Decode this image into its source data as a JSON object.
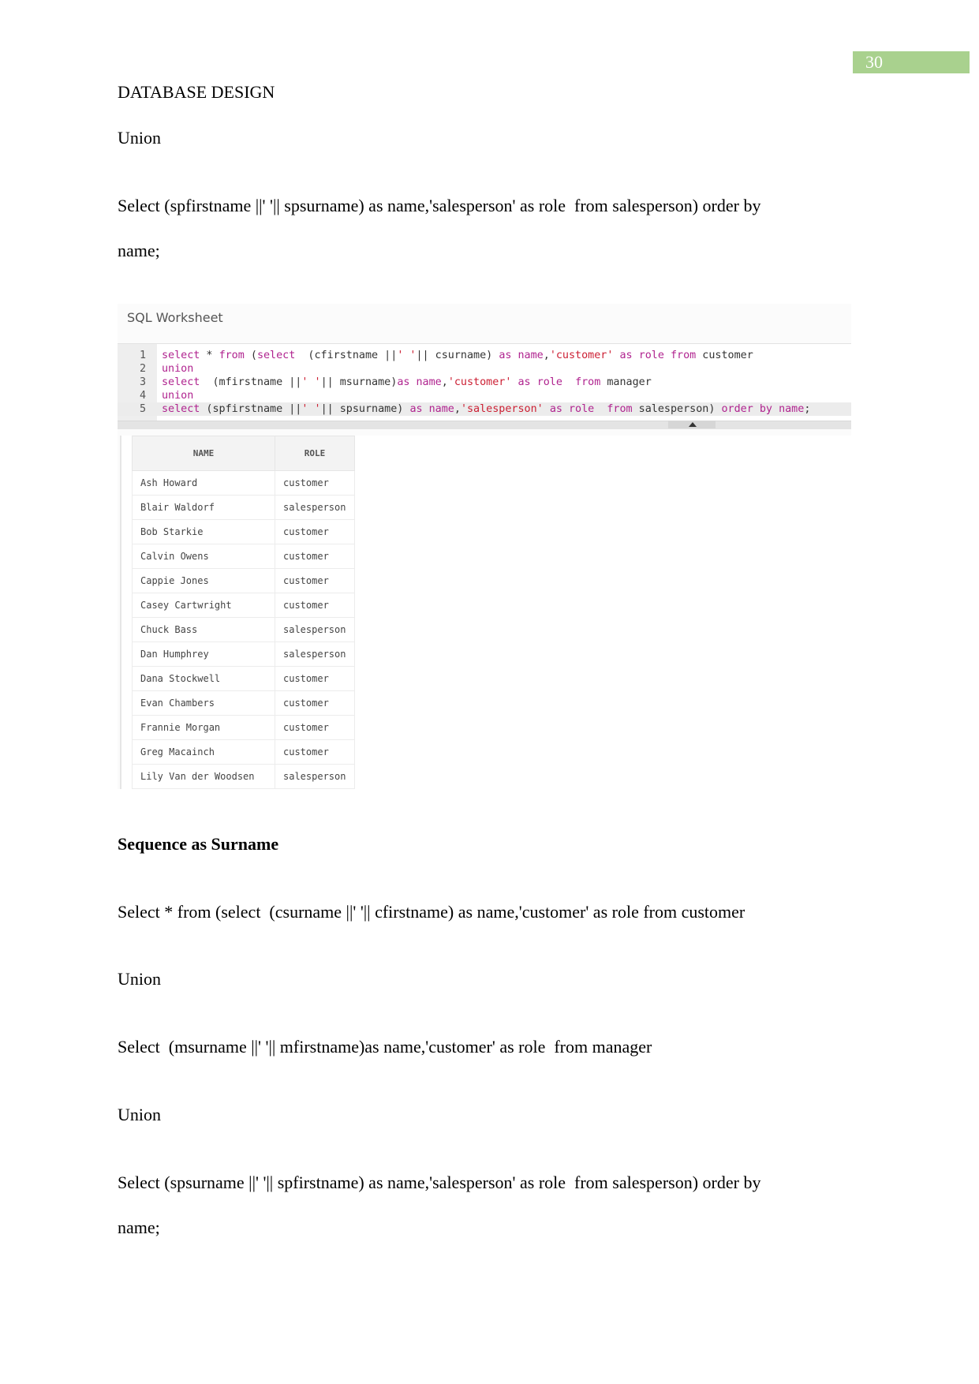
{
  "page": {
    "number": "30",
    "header": "DATABASE DESIGN",
    "accent_color": "#a9d18e"
  },
  "section1": {
    "line_union": "Union",
    "query_line1": "Select (spfirstname ||' '|| spsurname) as name,'salesperson' as role  from salesperson) order by",
    "query_line2": "name;"
  },
  "worksheet": {
    "title": "SQL Worksheet",
    "code_lines": [
      {
        "n": "1",
        "segments": [
          [
            "kw",
            "select"
          ],
          [
            "p",
            " * "
          ],
          [
            "kw",
            "from"
          ],
          [
            "p",
            " ("
          ],
          [
            "kw",
            "select"
          ],
          [
            "p",
            "  (cfirstname ||"
          ],
          [
            "str",
            "' '"
          ],
          [
            "p",
            "|| csurname) "
          ],
          [
            "kw",
            "as"
          ],
          [
            "p",
            " "
          ],
          [
            "kw",
            "name"
          ],
          [
            "p",
            ","
          ],
          [
            "str",
            "'customer'"
          ],
          [
            "p",
            " "
          ],
          [
            "kw",
            "as"
          ],
          [
            "p",
            " "
          ],
          [
            "kw",
            "role"
          ],
          [
            "p",
            " "
          ],
          [
            "kw",
            "from"
          ],
          [
            "p",
            " customer"
          ]
        ]
      },
      {
        "n": "2",
        "segments": [
          [
            "kw",
            "union"
          ]
        ]
      },
      {
        "n": "3",
        "segments": [
          [
            "kw",
            "select"
          ],
          [
            "p",
            "  (mfirstname ||"
          ],
          [
            "str",
            "' '"
          ],
          [
            "p",
            "|| msurname)"
          ],
          [
            "kw",
            "as"
          ],
          [
            "p",
            " "
          ],
          [
            "kw",
            "name"
          ],
          [
            "p",
            ","
          ],
          [
            "str",
            "'customer'"
          ],
          [
            "p",
            " "
          ],
          [
            "kw",
            "as"
          ],
          [
            "p",
            " "
          ],
          [
            "kw",
            "role"
          ],
          [
            "p",
            "  "
          ],
          [
            "kw",
            "from"
          ],
          [
            "p",
            " manager"
          ]
        ]
      },
      {
        "n": "4",
        "segments": [
          [
            "kw",
            "union"
          ]
        ]
      },
      {
        "n": "5",
        "segments": [
          [
            "kw",
            "select"
          ],
          [
            "p",
            " (spfirstname ||"
          ],
          [
            "str",
            "' '"
          ],
          [
            "p",
            "|| spsurname) "
          ],
          [
            "kw",
            "as"
          ],
          [
            "p",
            " "
          ],
          [
            "kw",
            "name"
          ],
          [
            "p",
            ","
          ],
          [
            "str",
            "'salesperson'"
          ],
          [
            "p",
            " "
          ],
          [
            "kw",
            "as"
          ],
          [
            "p",
            " "
          ],
          [
            "kw",
            "role"
          ],
          [
            "p",
            "  "
          ],
          [
            "kw",
            "from"
          ],
          [
            "p",
            " salesperson) "
          ],
          [
            "kw",
            "order"
          ],
          [
            "p",
            " "
          ],
          [
            "kw",
            "by"
          ],
          [
            "p",
            " "
          ],
          [
            "kw",
            "name"
          ],
          [
            "p",
            ";"
          ]
        ]
      }
    ],
    "active_line": 5,
    "results": {
      "columns": [
        "NAME",
        "ROLE"
      ],
      "rows": [
        [
          "Ash Howard",
          "customer"
        ],
        [
          "Blair Waldorf",
          "salesperson"
        ],
        [
          "Bob Starkie",
          "customer"
        ],
        [
          "Calvin Owens",
          "customer"
        ],
        [
          "Cappie Jones",
          "customer"
        ],
        [
          "Casey Cartwright",
          "customer"
        ],
        [
          "Chuck Bass",
          "salesperson"
        ],
        [
          "Dan Humphrey",
          "salesperson"
        ],
        [
          "Dana Stockwell",
          "customer"
        ],
        [
          "Evan Chambers",
          "customer"
        ],
        [
          "Frannie Morgan",
          "customer"
        ],
        [
          "Greg Macainch",
          "customer"
        ],
        [
          "Lily Van der Woodsen",
          "salesperson"
        ]
      ]
    }
  },
  "section2": {
    "heading": "Sequence as Surname",
    "line1": "Select * from (select  (csurname ||' '|| cfirstname) as name,'customer' as role from customer",
    "union1": "Union",
    "line2": "Select  (msurname ||' '|| mfirstname)as name,'customer' as role  from manager",
    "union2": "Union",
    "line3a": "Select (spsurname ||' '|| spfirstname) as name,'salesperson' as role  from salesperson) order by",
    "line3b": "name;"
  }
}
